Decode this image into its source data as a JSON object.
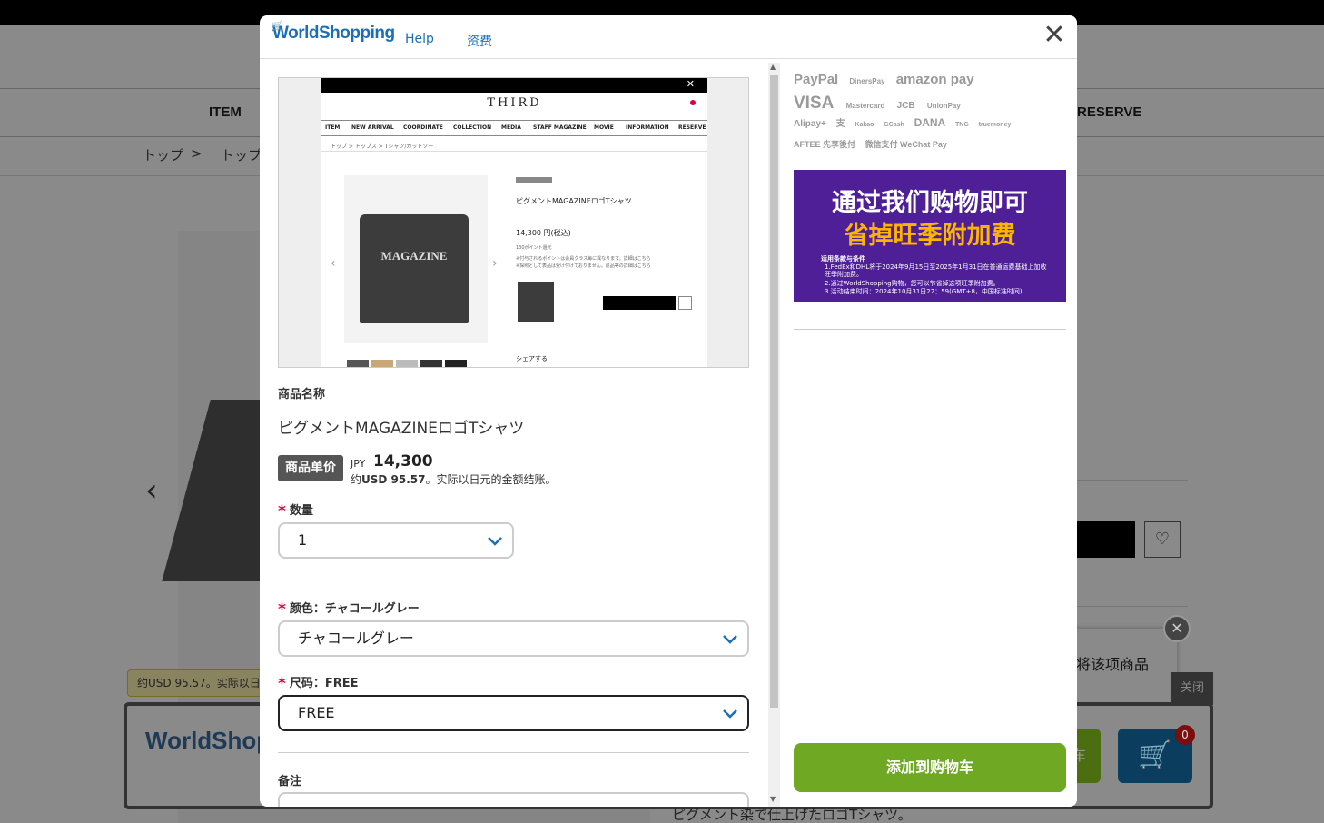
{
  "background": {
    "nav_items": [
      "ITEM",
      "RESERVE"
    ],
    "breadcrumb": [
      "トップ",
      ">",
      "トップ"
    ],
    "usd_tip": "约USD 95.57。实际以日元",
    "tooltip_text": "将该项商品",
    "close_bar": "关闭",
    "cart_count": "0",
    "ws_logo": "WorldShop",
    "product_desc": "ピグメント染で仕上げたロゴTシャツ。",
    "green_btn_text": "车"
  },
  "header": {
    "logo": "WorldShopping",
    "help": "Help",
    "fees": "资费"
  },
  "screenshot": {
    "brand": "THIRD",
    "nav": [
      "ITEM",
      "NEW ARRIVAL",
      "COORDINATE",
      "COLLECTION",
      "MEDIA",
      "STAFF MAGAZINE",
      "MOVIE",
      "INFORMATION",
      "RESERVE"
    ],
    "crumb": "トップ  >  トップス  >  Tシャツ/カットソー",
    "tee_text": "MAGAZINE",
    "title": "ピグメントMAGAZINEロゴTシャツ",
    "price": "14,300 円(税込)",
    "point": "130ポイント還元",
    "note1": "※付与されるポイントは会員クラス毎に異なります。詳細はこちら",
    "note2": "※探照として表品は受け付けておりません。返品等の詳細はこちら",
    "share": "シェアする"
  },
  "product": {
    "name_label": "商品名称",
    "name": "ピグメントMAGAZINEロゴTシャツ",
    "price_label": "商品单价",
    "currency": "JPY",
    "amount": "14,300",
    "approx_prefix": "约",
    "approx_usd": "USD 95.57",
    "approx_suffix": "。实际以日元的金额结账。"
  },
  "form": {
    "qty_label": "数量",
    "qty_value": "1",
    "color_label": "颜色：チャコールグレー",
    "color_value": "チャコールグレー",
    "size_label": "尺码：FREE",
    "size_value": "FREE",
    "note_label": "备注"
  },
  "payments": {
    "row1": [
      "PayPal",
      "DinersPay",
      "amazon pay"
    ],
    "row2": [
      "VISA",
      "Mastercard",
      "JCB",
      "UnionPay"
    ],
    "row3": [
      "Alipay+",
      "支",
      "Kakao",
      "GCash",
      "DANA",
      "TNG",
      "truemoney"
    ],
    "row4": [
      "AFTEE 先享後付",
      "微信支付 WeChat Pay"
    ]
  },
  "banner": {
    "line1": "通过我们购物即可",
    "line2": "省掉旺季附加费",
    "cond_title": "适用条款与条件",
    "items": [
      "1.FedEx和DHL将于2024年9月15日至2025年1月31日在普通运费基础上加收旺季附加费。",
      "2.通过WorldShopping购物，您可以节省掉这项旺季附加费。",
      "3.活动结束时间：2024年10月31日22：59(GMT+8，中国标准时间)"
    ]
  },
  "add_to_cart": "添加到购物车",
  "colors": {
    "brand_blue": "#1b6fb8",
    "green": "#6fa823",
    "banner_purple": "#4e1f97",
    "required_red": "#e4003a"
  }
}
